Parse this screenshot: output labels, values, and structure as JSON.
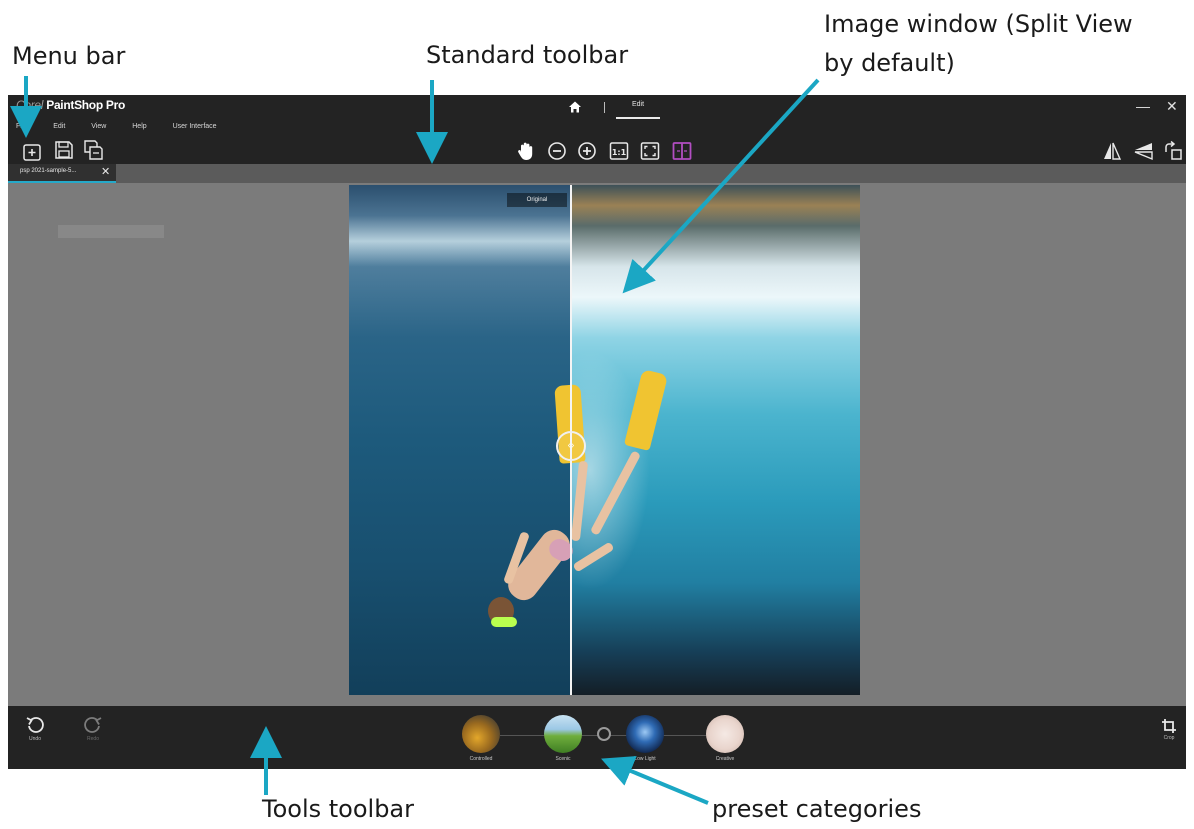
{
  "annotations": {
    "menu_bar": "Menu bar",
    "standard_toolbar": "Standard toolbar",
    "image_window_line1": "Image window (Split View",
    "image_window_line2": "by default)",
    "tools_toolbar": "Tools toolbar",
    "preset_categories": "preset categories",
    "arrow_color": "#1ba7c4"
  },
  "app": {
    "brand_prefix": "Corel",
    "brand_name": "PaintShop Pro",
    "menu": [
      "File",
      "Edit",
      "View",
      "Help",
      "User Interface"
    ],
    "nav": {
      "home_icon": "home-icon",
      "edit_tab": "Edit"
    },
    "window_controls": {
      "minimize": "—",
      "close": "✕"
    },
    "file_toolbar": [
      "open-icon",
      "save-icon",
      "save-as-icon"
    ],
    "view_toolbar": [
      "pan-hand-icon",
      "zoom-out-icon",
      "zoom-in-icon",
      "actual-size-icon",
      "fit-window-icon",
      "split-view-icon"
    ],
    "right_toolbar": [
      "flip-icon",
      "mirror-icon",
      "rotate-icon"
    ],
    "document_tab": {
      "label": "psp 2021-sample-5...",
      "close": "✕"
    },
    "image_window": {
      "original_label": "Original",
      "split_handle": "‹›"
    },
    "tools_toolbar": {
      "undo": "Undo",
      "redo": "Redo",
      "crop": "Crop"
    },
    "presets": [
      "Controlled",
      "Scenic",
      "Low Light",
      "Creative"
    ],
    "colors": {
      "title_bar": "#232323",
      "workspace": "#7b7b7b",
      "accent_tab": "#25a9c9",
      "split_view_active": "#b24ec2"
    }
  }
}
